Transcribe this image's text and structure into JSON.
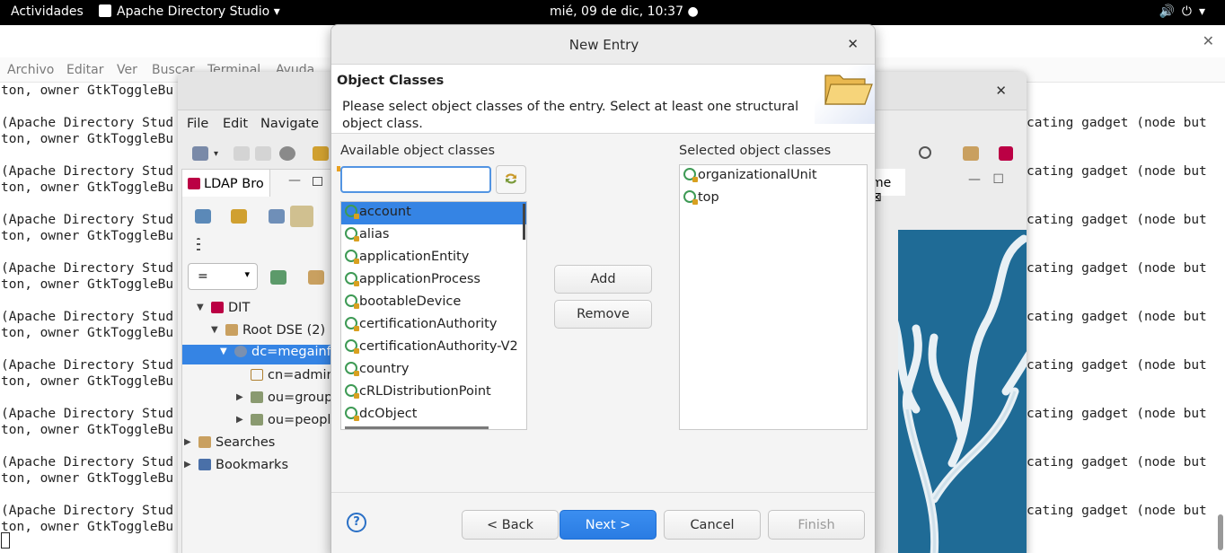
{
  "topbar": {
    "activities": "Actividades",
    "app_name": "Apache Directory Studio",
    "clock": "mié, 09 de dic, 10:37"
  },
  "terminal": {
    "menu": [
      "Archivo",
      "Editar",
      "Ver",
      "Buscar",
      "Terminal",
      "Ayuda"
    ],
    "first_line": "ton, owner GtkToggleBu",
    "line_a": "(Apache Directory Stud",
    "line_b": "ton, owner GtkToggleBu",
    "right_text": "cating gadget (node but"
  },
  "studio": {
    "menu": [
      "File",
      "Edit",
      "Navigate"
    ],
    "tab_label": "LDAP Bro",
    "filter_value": "=",
    "tree": {
      "dit": "DIT",
      "root_dse": "Root DSE (2)",
      "dc": "dc=megainfo",
      "cn_admin": "cn=admin",
      "ou_group": "ou=group (",
      "ou_people": "ou=people",
      "searches": "Searches",
      "bookmarks": "Bookmarks"
    },
    "right_tab": "me"
  },
  "dialog": {
    "title": "New Entry",
    "heading": "Object Classes",
    "description": "Please select object classes of the entry. Select at least one structural object class.",
    "available_label": "Available object classes",
    "selected_label": "Selected object classes",
    "search_value": "",
    "available": [
      "account",
      "alias",
      "applicationEntity",
      "applicationProcess",
      "bootableDevice",
      "certificationAuthority",
      "certificationAuthority-V2",
      "country",
      "cRLDistributionPoint",
      "dcObject"
    ],
    "selected_available": "account",
    "selected": [
      "organizationalUnit",
      "top"
    ],
    "add_label": "Add",
    "remove_label": "Remove",
    "help_label": "?",
    "back_label": "< Back",
    "next_label": "Next >",
    "cancel_label": "Cancel",
    "finish_label": "Finish"
  },
  "colors": {
    "accent": "#3584e4",
    "next_button": "#2a7ce3",
    "objectclass_icon": "#3e9a55"
  }
}
